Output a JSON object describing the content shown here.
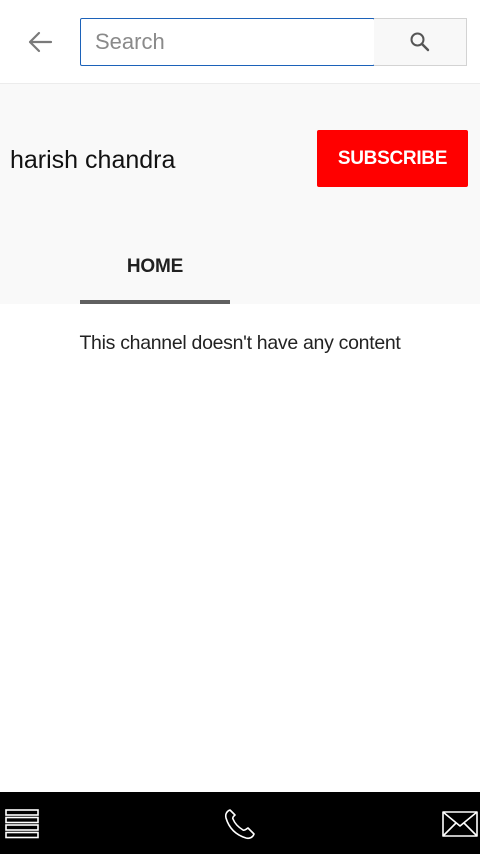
{
  "search": {
    "placeholder": "Search",
    "value": ""
  },
  "icons": {
    "back": "arrow-left-icon",
    "search": "magnifier-icon",
    "menu": "hamburger-menu-icon",
    "phone": "phone-icon",
    "mail": "envelope-icon"
  },
  "channel": {
    "name": "harish chandra",
    "subscribe_label": "SUBSCRIBE"
  },
  "tabs": [
    {
      "label": "HOME",
      "active": true
    }
  ],
  "content": {
    "empty_message": "This channel doesn't have any content"
  },
  "colors": {
    "subscribe_bg": "#ff0000",
    "search_border": "#1c62b9",
    "bottom_bar": "#000000",
    "header_bg": "#f9f9f9"
  }
}
